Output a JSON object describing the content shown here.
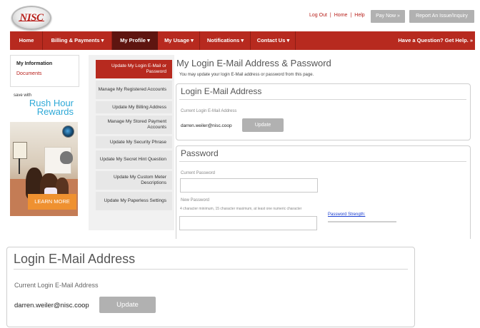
{
  "header": {
    "logo_text": "NISC",
    "links": [
      "Log Out",
      "Home",
      "Help"
    ],
    "pay_now": "Pay Now »",
    "report": "Report An Issue/Inquiry"
  },
  "nav": {
    "items": [
      "Home",
      "Billing & Payments ▾",
      "My Profile ▾",
      "My Usage ▾",
      "Notifications ▾",
      "Contact Us ▾"
    ],
    "question": "Have a Question? Get Help. »"
  },
  "left": {
    "my_information": "My Information",
    "documents": "Documents"
  },
  "promo": {
    "save_with": "save with",
    "rush_line1": "Rush Hour",
    "rush_line2": "Rewards",
    "learn_more": "LEARN MORE"
  },
  "subnav": {
    "items": [
      "Update My Login E-Mail or Password",
      "Manage My Registered Accounts",
      "Update My Billing Address",
      "Manage My Stored Payment Accounts",
      "Update My Security Phrase",
      "Update My Secret Hint Question",
      "Update My Custom Meter Descriptions",
      "Update My Paperless Settings"
    ]
  },
  "main": {
    "title": "My Login E-Mail Address & Password",
    "subtitle": "You may update your login E-Mail address or password from this page."
  },
  "login_panel": {
    "title": "Login E-Mail Address",
    "current_label": "Current Login E-Mail Address",
    "email": "darren.weiler@nisc.coop",
    "update": "Update"
  },
  "password_panel": {
    "title": "Password",
    "current_label": "Current Password",
    "new_label": "New Password",
    "hint": "4 character minimum, 15 character maximum, at least one numeric character",
    "strength": "Password Strength:"
  },
  "zoom_panel": {
    "title": "Login E-Mail Address",
    "current_label": "Current Login E-Mail Address",
    "email": "darren.weiler@nisc.coop",
    "update": "Update"
  },
  "colors": {
    "brand_red": "#b72a1f",
    "active_nav": "#5e1510",
    "button_gray": "#b1b1b1",
    "link_blue": "#1a3ed1",
    "promo_blue": "#2ea9d7",
    "promo_orange": "#ef9130"
  }
}
